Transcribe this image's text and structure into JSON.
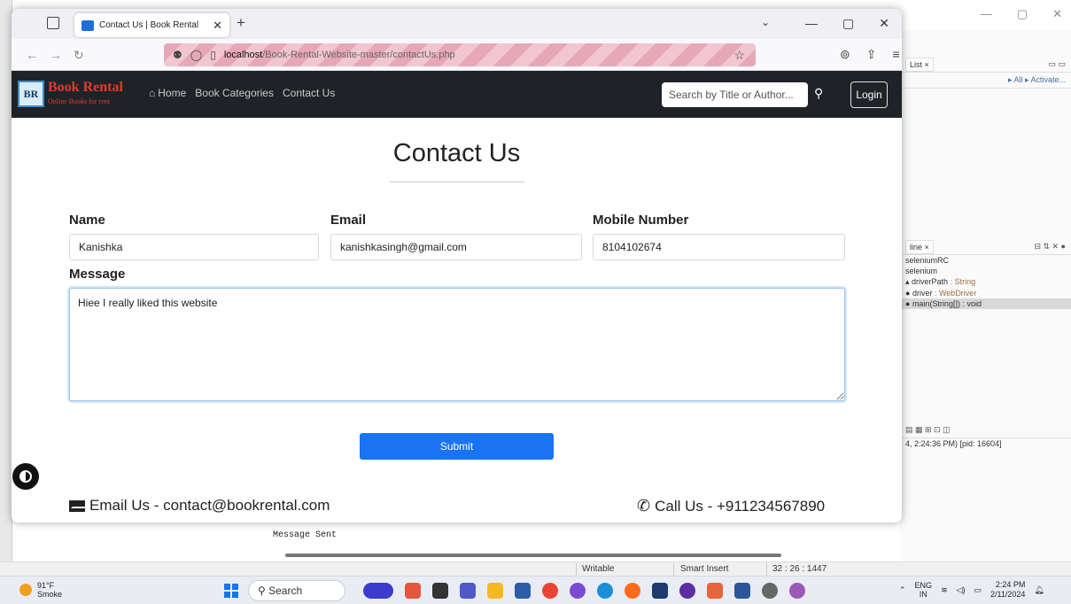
{
  "ide": {
    "right_tabs": [
      "List ×",
      "line ×"
    ],
    "actions": "▸ All ▸ Activate...",
    "outline": [
      {
        "text": "seleniumRC"
      },
      {
        "text": "selenium"
      },
      {
        "text": "driverPath",
        "type": ": String"
      },
      {
        "text": "driver",
        "type": ": WebDriver"
      },
      {
        "text": "main(String[]) : void"
      }
    ],
    "console_header": "4, 2:24:36 PM) [pid: 16604]",
    "console_line": "Message Sent",
    "status": {
      "writable": "Writable",
      "insert": "Smart Insert",
      "position": "32 : 26 : 1447"
    }
  },
  "browser": {
    "tab_title": "Contact Us | Book Rental",
    "url_host": "localhost",
    "url_path": "/Book-Rental-Website-master/contactUs.php"
  },
  "site": {
    "brand_badge": "BR",
    "brand_name": "Book Rental",
    "brand_tagline": "Online Books for rent",
    "nav": {
      "home": "Home",
      "categories": "Book Categories",
      "contact": "Contact Us"
    },
    "search_placeholder": "Search by Title or Author...",
    "login": "Login",
    "title": "Contact Us",
    "form": {
      "name_label": "Name",
      "name_value": "Kanishka",
      "email_label": "Email",
      "email_value": "kanishkasingh@gmail.com",
      "mobile_label": "Mobile Number",
      "mobile_value": "8104102674",
      "message_label": "Message",
      "message_value": "Hiee I really liked this website",
      "submit": "Submit"
    },
    "footer": {
      "email": "Email Us - contact@bookrental.com",
      "phone": "Call Us - +911234567890"
    }
  },
  "taskbar": {
    "temp": "91°F",
    "weather": "Smoke",
    "search": "Search",
    "lang": "ENG",
    "region": "IN",
    "time": "2:24 PM",
    "date": "2/11/2024"
  },
  "colors": {
    "navbar": "#1f2327",
    "brand": "#e33a2d",
    "submit": "#1a73f2",
    "url_stripe": "#e6a7b6"
  }
}
